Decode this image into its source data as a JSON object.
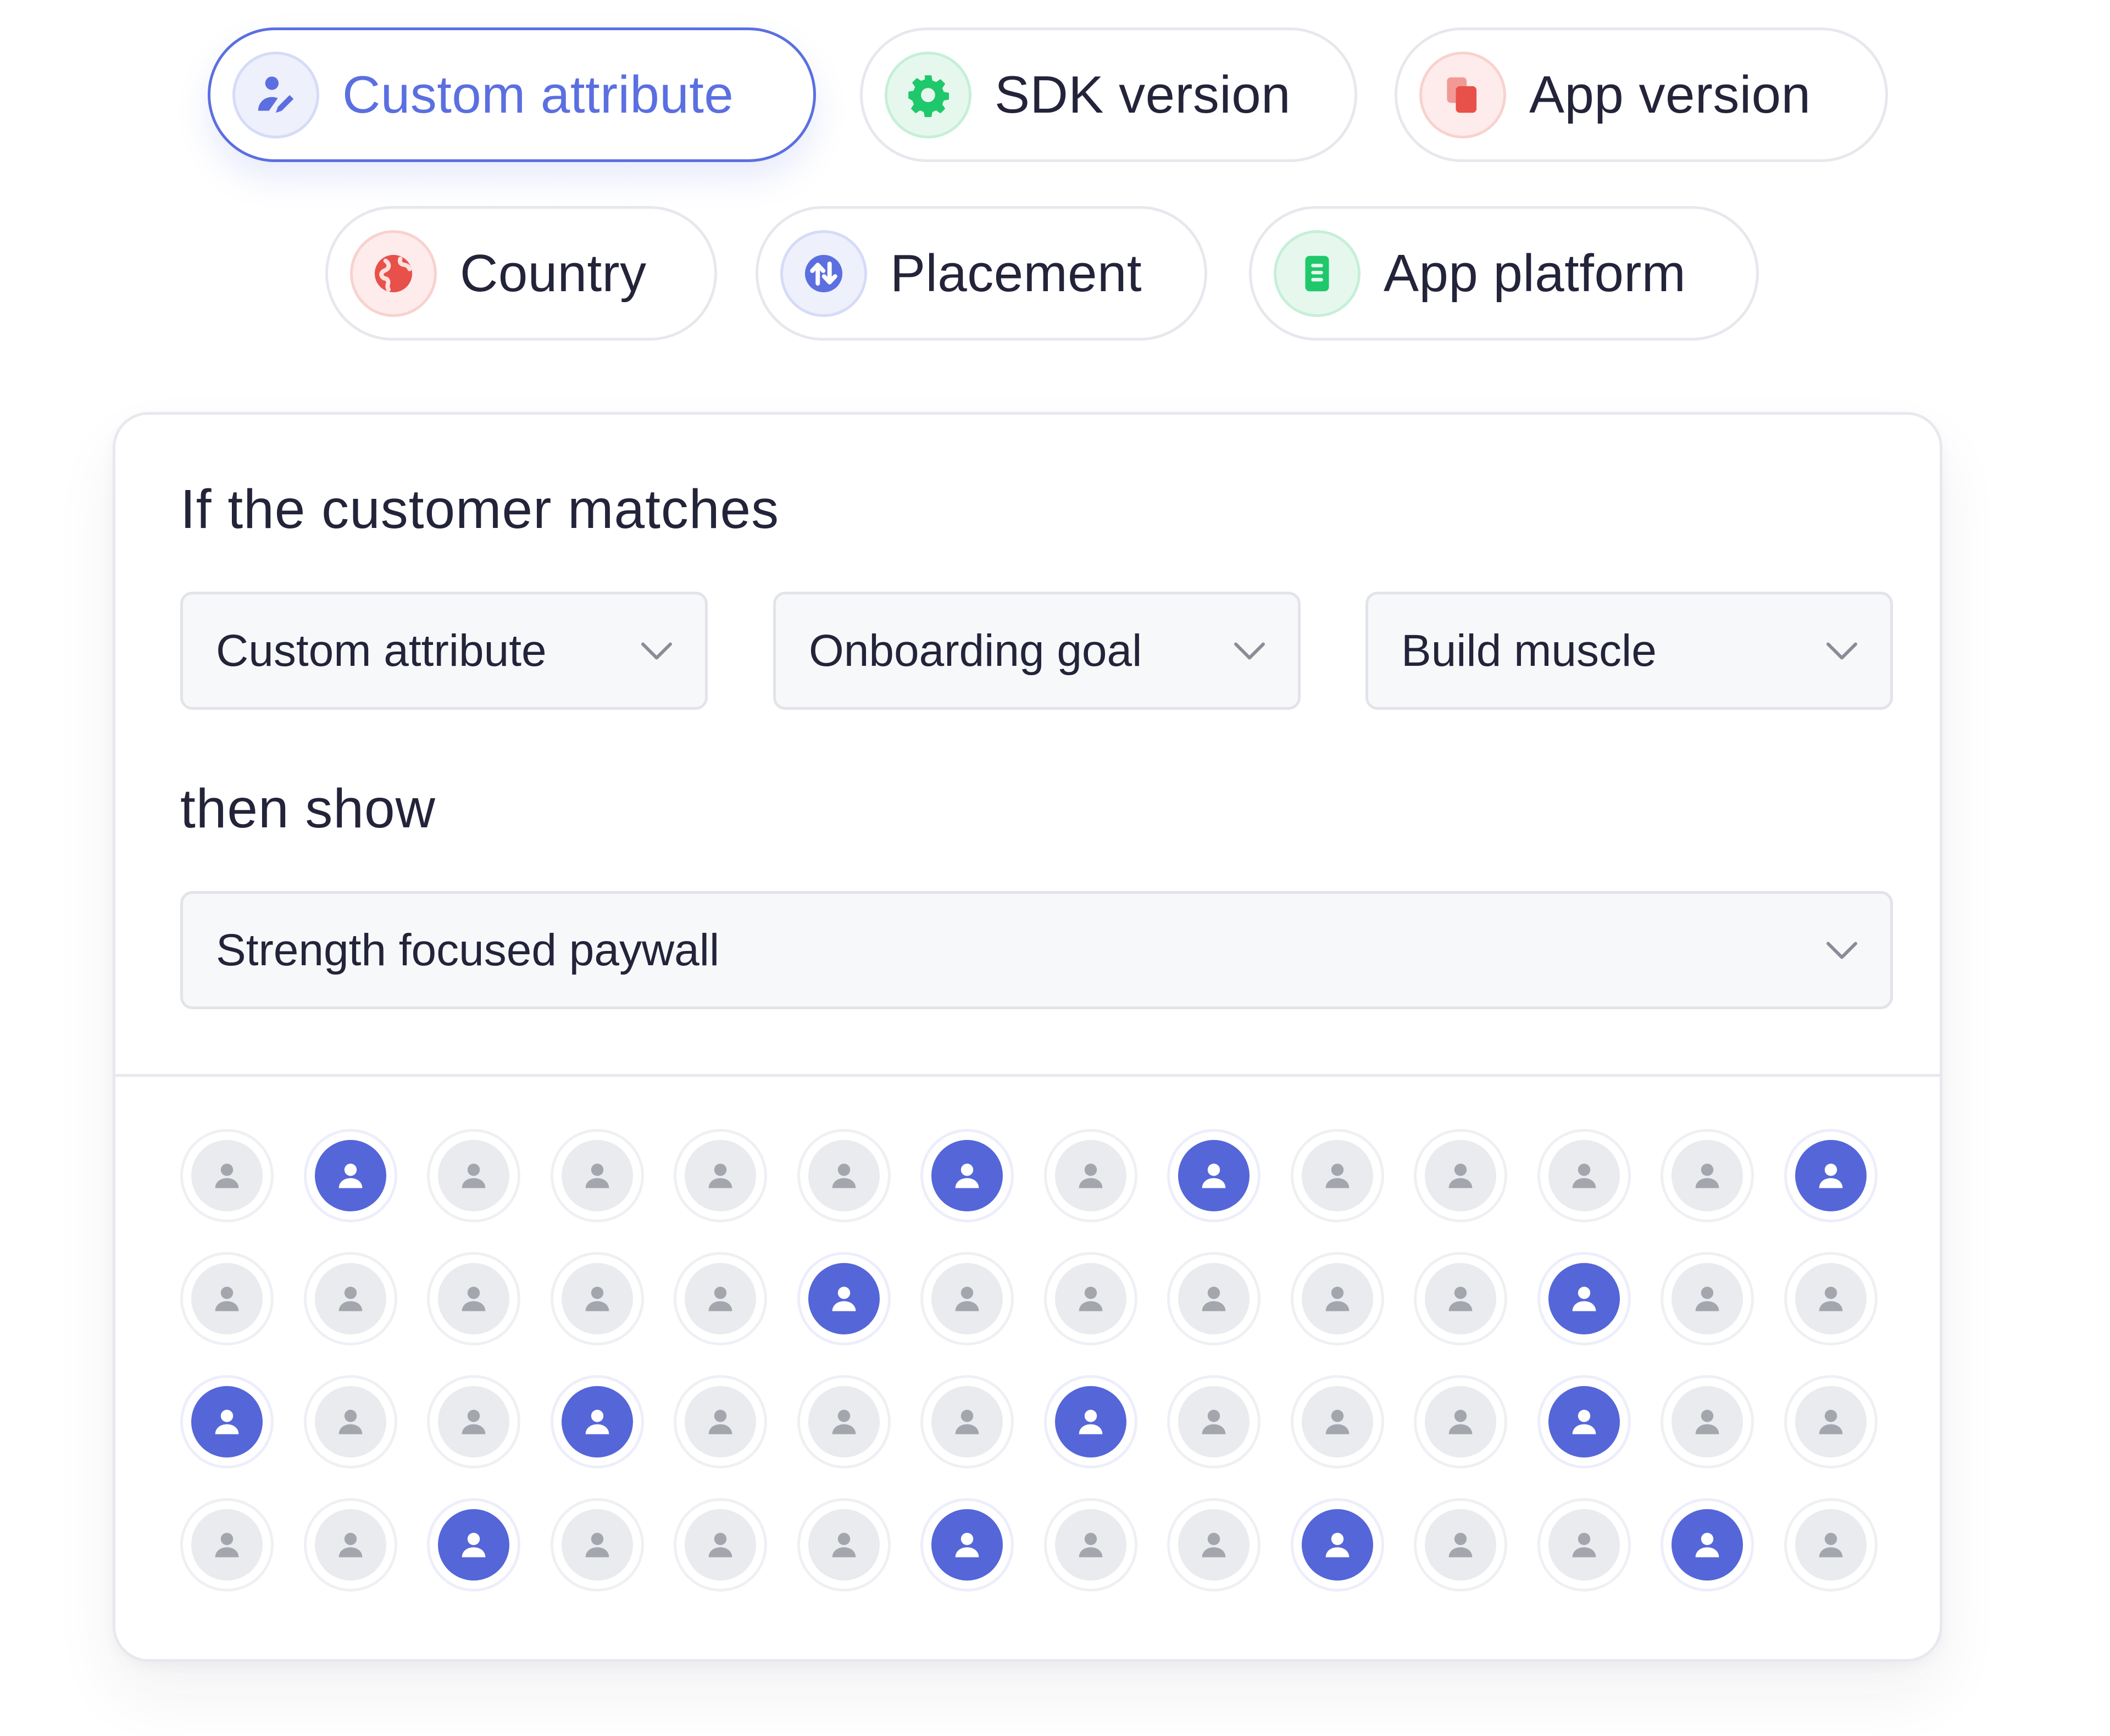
{
  "filters": [
    {
      "label": "Custom attribute",
      "icon": "user-pen-icon",
      "active": true
    },
    {
      "label": "SDK version",
      "icon": "gear-icon",
      "active": false
    },
    {
      "label": "App version",
      "icon": "copy-icon",
      "active": false
    },
    {
      "label": "Country",
      "icon": "globe-icon",
      "active": false
    },
    {
      "label": "Placement",
      "icon": "swap-arrows-icon",
      "active": false
    },
    {
      "label": "App platform",
      "icon": "phone-icon",
      "active": false
    }
  ],
  "rule": {
    "condition_heading": "If the customer matches",
    "attribute_select": "Custom attribute",
    "key_select": "Onboarding goal",
    "value_select": "Build muscle",
    "action_heading": "then show",
    "paywall_select": "Strength focused paywall"
  },
  "audience": {
    "columns": 14,
    "grid": [
      [
        0,
        1,
        0,
        0,
        0,
        0,
        1,
        0,
        1,
        0,
        0,
        0,
        0,
        1
      ],
      [
        0,
        0,
        0,
        0,
        0,
        1,
        0,
        0,
        0,
        0,
        0,
        1,
        0,
        0
      ],
      [
        1,
        0,
        0,
        1,
        0,
        0,
        0,
        1,
        0,
        0,
        0,
        1,
        0,
        0
      ],
      [
        0,
        0,
        1,
        0,
        0,
        0,
        1,
        0,
        0,
        1,
        0,
        0,
        1,
        0
      ]
    ]
  },
  "colors": {
    "accent": "#5b6fe0",
    "avatar_highlight": "#5566d8",
    "avatar_muted": "#eaebee",
    "green": "#1fc86b",
    "red": "#e8504a"
  }
}
